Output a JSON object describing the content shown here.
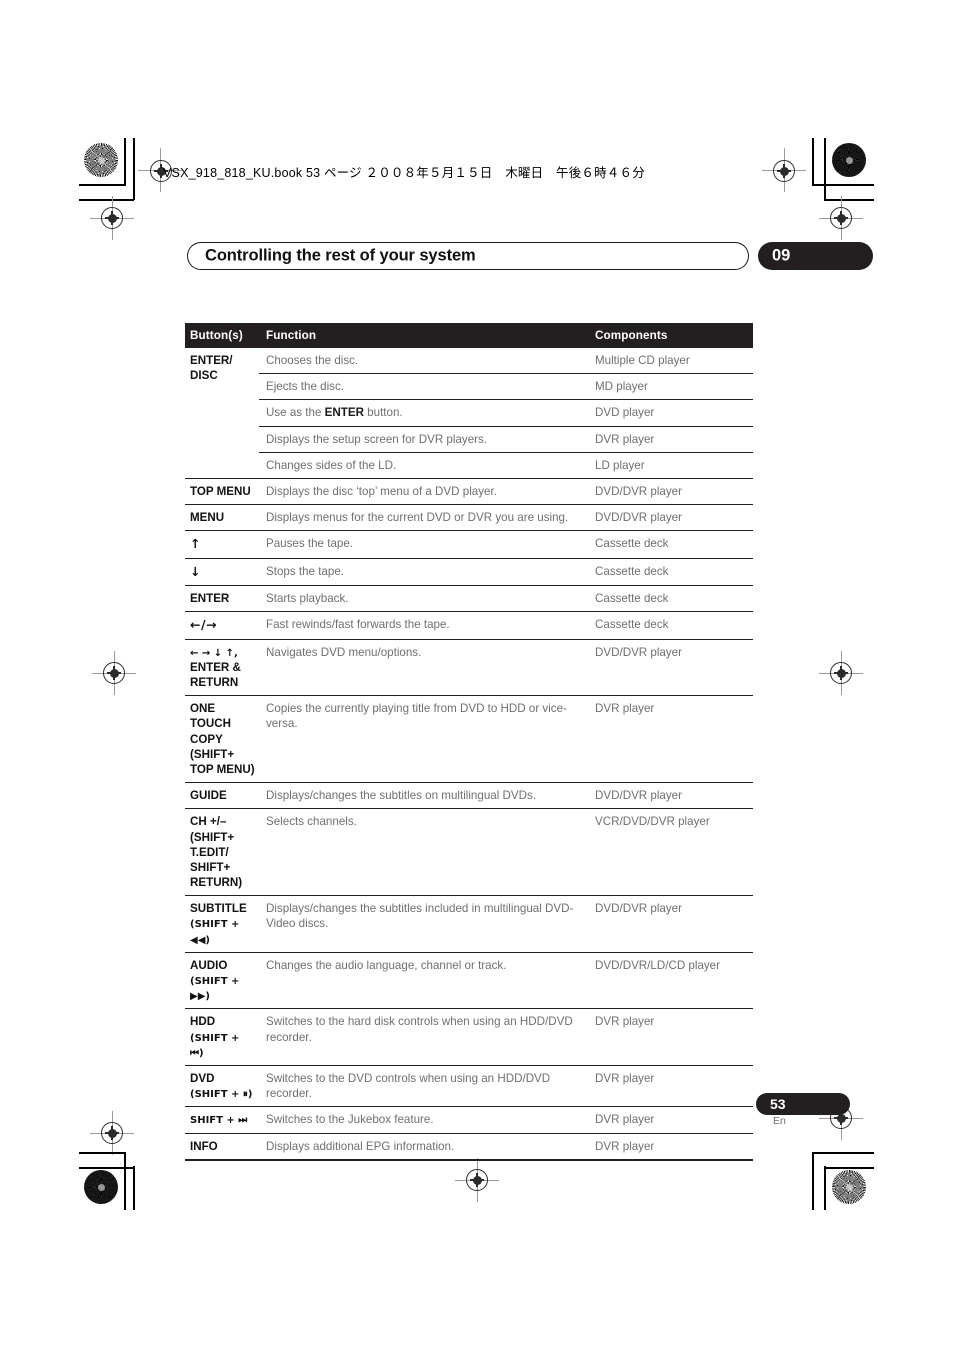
{
  "print_marks": {
    "file_stamp": "VSX_918_818_KU.book  53 ページ  ２００８年５月１５日　木曜日　午後６時４６分"
  },
  "header": {
    "title": "Controlling the rest of your system",
    "chapter": "09"
  },
  "table": {
    "columns": [
      "Button(s)",
      "Function",
      "Components"
    ],
    "rows": [
      {
        "button": "ENTER/\nDISC",
        "button_span": 5,
        "function": "Chooses the disc.",
        "components": "Multiple CD player",
        "first": true
      },
      {
        "button": "",
        "function": "Ejects the disc.",
        "components": "MD player",
        "norule": true
      },
      {
        "button": "",
        "function_pre": "Use as the ",
        "function_bold": "ENTER",
        "function_post": " button.",
        "function": "Use as the ENTER button.",
        "components": "DVD player",
        "norule": true
      },
      {
        "button": "",
        "function": "Displays the setup screen for DVR players.",
        "components": "DVR player",
        "norule": true
      },
      {
        "button": "",
        "function": "Changes sides of the LD.",
        "components": "LD player",
        "norule": true
      },
      {
        "button": "TOP MENU",
        "function": "Displays the disc ‘top’ menu of a DVD player.",
        "components": "DVD/DVR player"
      },
      {
        "button": "MENU",
        "function": "Displays menus for the current DVD or DVR you are using.",
        "components": "DVD/DVR player"
      },
      {
        "button": "↑",
        "glyph": true,
        "function": "Pauses the tape.",
        "components": "Cassette deck"
      },
      {
        "button": "↓",
        "glyph": true,
        "function": "Stops the tape.",
        "components": "Cassette deck"
      },
      {
        "button": "ENTER",
        "function": "Starts playback.",
        "components": "Cassette deck"
      },
      {
        "button": "←/→",
        "glyph": true,
        "function": "Fast rewinds/fast forwards the tape.",
        "components": "Cassette deck"
      },
      {
        "button": "← → ↓ ↑,\nENTER &\nRETURN",
        "function": "Navigates DVD menu/options.",
        "components": "DVD/DVR player"
      },
      {
        "button": "ONE TOUCH\nCOPY (SHIFT+\nTOP MENU)",
        "function": "Copies the currently playing title from DVD to HDD or vice-versa.",
        "components": "DVR player"
      },
      {
        "button": "GUIDE",
        "function": "Displays/changes the subtitles on multilingual DVDs.",
        "components": "DVD/DVR player"
      },
      {
        "button": "CH +/–\n(SHIFT+\nT.EDIT/\nSHIFT+\nRETURN)",
        "function": "Selects channels.",
        "components": "VCR/DVD/DVR player"
      },
      {
        "button": "SUBTITLE\n(SHIFT + ◀◀)",
        "function": "Displays/changes the subtitles included in multilingual DVD-Video discs.",
        "components": "DVD/DVR player"
      },
      {
        "button": "AUDIO\n(SHIFT + ▶▶)",
        "function": "Changes the audio language, channel or track.",
        "components": "DVD/DVR/LD/CD player"
      },
      {
        "button": "HDD\n(SHIFT + ⏮)",
        "function": "Switches to the hard disk controls when using an HDD/DVD recorder.",
        "components": "DVR player"
      },
      {
        "button": "DVD\n(SHIFT + ⏸)",
        "function": "Switches to the DVD controls when using an HDD/DVD recorder.",
        "components": "DVR player"
      },
      {
        "button": "SHIFT + ⏭",
        "function": "Switches to the Jukebox feature.",
        "components": "DVR player"
      },
      {
        "button": "INFO",
        "function": "Displays additional EPG information.",
        "components": "DVR player"
      }
    ]
  },
  "footer": {
    "page_number": "53",
    "language": "En"
  },
  "colors": {
    "ink_black": "#231f20",
    "body_grey": "#6f6f6f",
    "paper": "#ffffff"
  }
}
